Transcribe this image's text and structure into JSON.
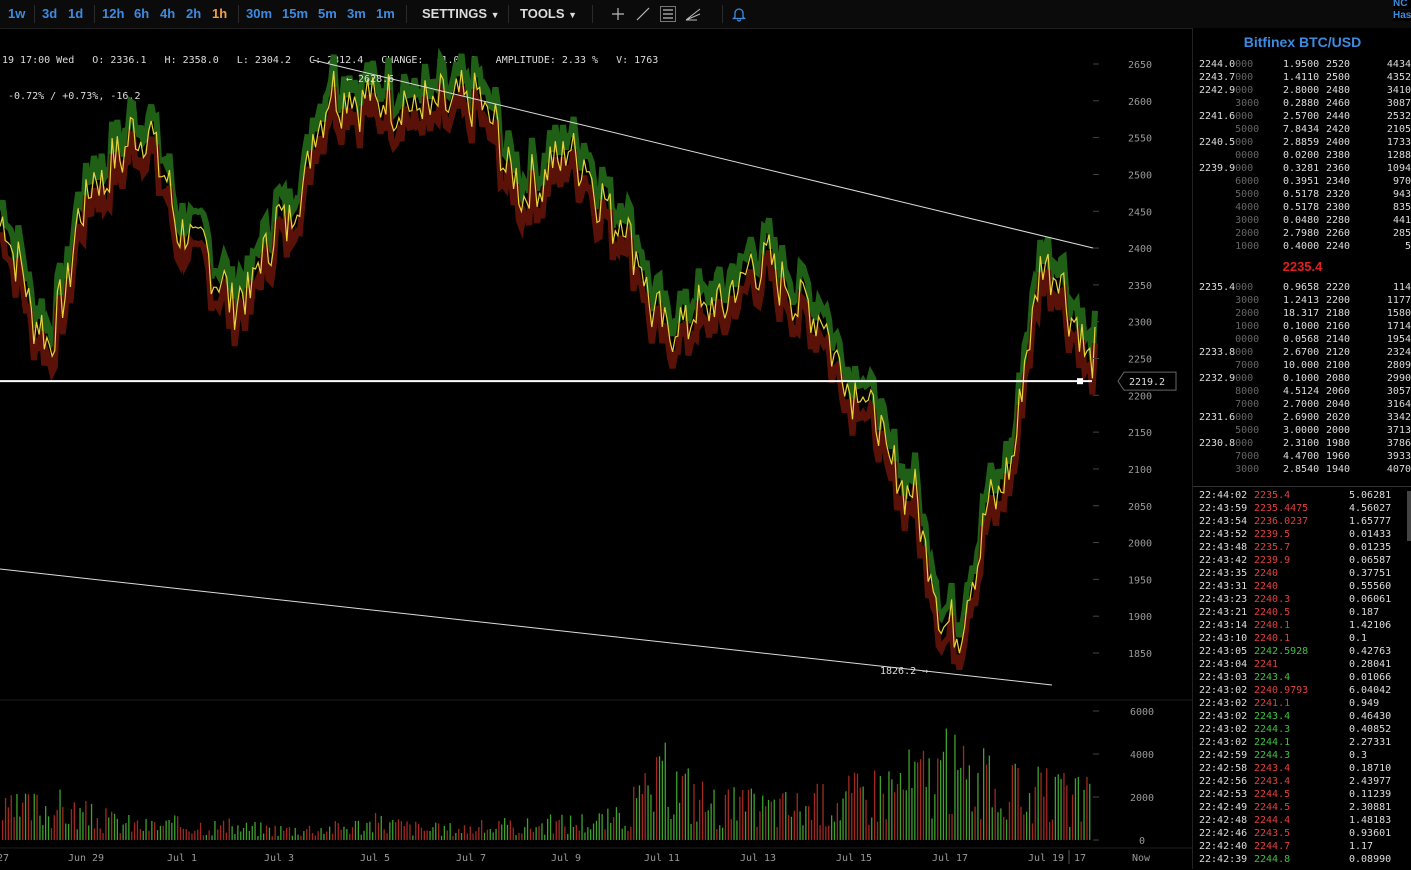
{
  "toolbar": {
    "timeframes": [
      {
        "label": "1w",
        "active": false
      },
      {
        "label": "3d",
        "active": false
      },
      {
        "label": "1d",
        "active": false
      },
      {
        "label": "12h",
        "active": false
      },
      {
        "label": "6h",
        "active": false
      },
      {
        "label": "4h",
        "active": false
      },
      {
        "label": "2h",
        "active": false
      },
      {
        "label": "1h",
        "active": true
      },
      {
        "label": "30m",
        "active": false
      },
      {
        "label": "15m",
        "active": false
      },
      {
        "label": "5m",
        "active": false
      },
      {
        "label": "3m",
        "active": false
      },
      {
        "label": "1m",
        "active": false
      }
    ],
    "settings_label": "SETTINGS",
    "tools_label": "TOOLS",
    "tool_icons": [
      "crosshair-icon",
      "line-draw-icon",
      "horizontal-lines-icon",
      "fan-icon",
      "bell-icon"
    ],
    "corner_line1": "NC",
    "corner_line2": "Has"
  },
  "ohlc": {
    "line1": "19 17:00 Wed   O: 2336.1   H: 2358.0   L: 2304.2   C: 2312.4   CHANGE:  -1.01 %   AMPLITUDE: 2.33 %   V: 1763",
    "line2": " -0.72% / +0.73%, -16.2"
  },
  "chart": {
    "price_axis_ticks": [
      2650,
      2600,
      2550,
      2500,
      2450,
      2400,
      2350,
      2300,
      2250,
      2200,
      2150,
      2100,
      2050,
      2000,
      1950,
      1900,
      1850
    ],
    "volume_axis_ticks": [
      6000,
      4000,
      2000,
      0
    ],
    "date_labels": [
      "27",
      "Jun 29",
      "Jul 1",
      "Jul 3",
      "Jul 5",
      "Jul 7",
      "Jul 9",
      "Jul 11",
      "Jul 13",
      "Jul 15",
      "Jul 17",
      "Jul 19",
      "17",
      "Now"
    ],
    "high_label": "← 2628.6",
    "low_label": "1826.2 →",
    "current_price_label": "2219.2",
    "current_price": 2219.2,
    "colors": {
      "up": "#3fa02f",
      "down": "#a02a20",
      "price_line": "#e8d23a",
      "area_up": "#1f5f16",
      "area_down": "#5a1208"
    }
  },
  "chart_data": {
    "type": "line",
    "title": "",
    "xlabel": "",
    "ylabel": "",
    "ylim": [
      1810,
      2680
    ],
    "x": [
      "Jun 27",
      "Jun 28",
      "Jun 29",
      "Jun 30",
      "Jul 1",
      "Jul 2",
      "Jul 3",
      "Jul 4",
      "Jul 5",
      "Jul 6",
      "Jul 7",
      "Jul 8",
      "Jul 9",
      "Jul 10",
      "Jul 11",
      "Jul 12",
      "Jul 13",
      "Jul 14",
      "Jul 15",
      "Jul 16",
      "Jul 17",
      "Jul 18",
      "Jul 19",
      "Jul 20"
    ],
    "series": [
      {
        "values": [
          2430,
          2280,
          2490,
          2560,
          2410,
          2330,
          2440,
          2610,
          2600,
          2590,
          2600,
          2480,
          2530,
          2440,
          2290,
          2320,
          2380,
          2320,
          2210,
          2080,
          1880,
          2070,
          2380,
          2250
        ]
      }
    ],
    "volume": {
      "ylim": [
        0,
        6500
      ],
      "approx_values": [
        1500,
        2000,
        1200,
        800,
        900,
        700,
        600,
        700,
        1000,
        600,
        700,
        800,
        1000,
        1200,
        3500,
        2000,
        1800,
        1900,
        2500,
        3300,
        4000,
        2800,
        2500,
        2200
      ]
    },
    "grid": false,
    "legend": "none"
  },
  "sidebar": {
    "title": "Bitfinex BTC/USD",
    "asks": [
      [
        "2244.0",
        "000",
        "1.9500",
        "2520",
        "4434"
      ],
      [
        "2243.7",
        "000",
        "1.4110",
        "2500",
        "4352"
      ],
      [
        "2242.9",
        "000",
        "2.8000",
        "2480",
        "3410"
      ],
      [
        "",
        "3000",
        "0.2880",
        "2460",
        "3087"
      ],
      [
        "2241.6",
        "000",
        "2.5700",
        "2440",
        "2532"
      ],
      [
        "",
        "5000",
        "7.8434",
        "2420",
        "2105"
      ],
      [
        "2240.5",
        "000",
        "2.8859",
        "2400",
        "1733"
      ],
      [
        "",
        "0000",
        "0.0200",
        "2380",
        "1288"
      ],
      [
        "2239.9",
        "000",
        "0.3281",
        "2360",
        "1094"
      ],
      [
        "",
        "6000",
        "0.3951",
        "2340",
        "970"
      ],
      [
        "",
        "5000",
        "0.5178",
        "2320",
        "943"
      ],
      [
        "",
        "4000",
        "0.5178",
        "2300",
        "835"
      ],
      [
        "",
        "3000",
        "0.0480",
        "2280",
        "441"
      ],
      [
        "",
        "2000",
        "2.7980",
        "2260",
        "285"
      ],
      [
        "",
        "1000",
        "0.4000",
        "2240",
        "5"
      ]
    ],
    "last_price": "2235.4",
    "bids": [
      [
        "2235.4",
        "000",
        "0.9658",
        "2220",
        "114"
      ],
      [
        "",
        "3000",
        "1.2413",
        "2200",
        "1177"
      ],
      [
        "",
        "2000",
        "18.317",
        "2180",
        "1580"
      ],
      [
        "",
        "1000",
        "0.1000",
        "2160",
        "1714"
      ],
      [
        "",
        "0000",
        "0.0568",
        "2140",
        "1954"
      ],
      [
        "2233.8",
        "000",
        "2.6700",
        "2120",
        "2324"
      ],
      [
        "",
        "7000",
        "10.000",
        "2100",
        "2809"
      ],
      [
        "2232.9",
        "000",
        "0.1000",
        "2080",
        "2990"
      ],
      [
        "",
        "8000",
        "4.5124",
        "2060",
        "3057"
      ],
      [
        "",
        "7000",
        "2.7000",
        "2040",
        "3164"
      ],
      [
        "2231.6",
        "000",
        "2.6900",
        "2020",
        "3342"
      ],
      [
        "",
        "5000",
        "3.0000",
        "2000",
        "3713"
      ],
      [
        "2230.8",
        "000",
        "2.3100",
        "1980",
        "3786"
      ],
      [
        "",
        "7000",
        "4.4700",
        "1960",
        "3933"
      ],
      [
        "",
        "3000",
        "2.8540",
        "1940",
        "4070"
      ]
    ],
    "trades": [
      [
        "22:44:02",
        "2235.4",
        "5.06281",
        "red"
      ],
      [
        "22:43:59",
        "2235.4475",
        "4.56027",
        "red"
      ],
      [
        "22:43:54",
        "2236.0237",
        "1.65777",
        "red"
      ],
      [
        "22:43:52",
        "2239.5",
        "0.01433",
        "red"
      ],
      [
        "22:43:48",
        "2235.7",
        "0.01235",
        "red"
      ],
      [
        "22:43:42",
        "2239.9",
        "0.06587",
        "red"
      ],
      [
        "22:43:35",
        "2240",
        "0.37751",
        "red"
      ],
      [
        "22:43:31",
        "2240",
        "0.55560",
        "red"
      ],
      [
        "22:43:23",
        "2240.3",
        "0.06061",
        "red"
      ],
      [
        "22:43:21",
        "2240.5",
        "0.187",
        "red"
      ],
      [
        "22:43:14",
        "2240.1",
        "1.42106",
        "red"
      ],
      [
        "22:43:10",
        "2240.1",
        "0.1",
        "red"
      ],
      [
        "22:43:05",
        "2242.5928",
        "0.42763",
        "green"
      ],
      [
        "22:43:04",
        "2241",
        "0.28041",
        "red"
      ],
      [
        "22:43:03",
        "2243.4",
        "0.01066",
        "green"
      ],
      [
        "22:43:02",
        "2240.9793",
        "6.04042",
        "red"
      ],
      [
        "22:43:02",
        "2241.1",
        "0.949",
        "red"
      ],
      [
        "22:43:02",
        "2243.4",
        "0.46430",
        "green"
      ],
      [
        "22:43:02",
        "2244.3",
        "0.40852",
        "green"
      ],
      [
        "22:43:02",
        "2244.1",
        "2.27331",
        "green"
      ],
      [
        "22:42:59",
        "2244.3",
        "0.3",
        "green"
      ],
      [
        "22:42:58",
        "2243.4",
        "0.18710",
        "red"
      ],
      [
        "22:42:56",
        "2243.4",
        "2.43977",
        "red"
      ],
      [
        "22:42:53",
        "2244.5",
        "0.11239",
        "red"
      ],
      [
        "22:42:49",
        "2244.5",
        "2.30881",
        "red"
      ],
      [
        "22:42:48",
        "2244.4",
        "1.48183",
        "red"
      ],
      [
        "22:42:46",
        "2243.5",
        "0.93601",
        "red"
      ],
      [
        "22:42:40",
        "2244.7",
        "1.17",
        "red"
      ],
      [
        "22:42:39",
        "2244.8",
        "0.08990",
        "green"
      ]
    ]
  }
}
